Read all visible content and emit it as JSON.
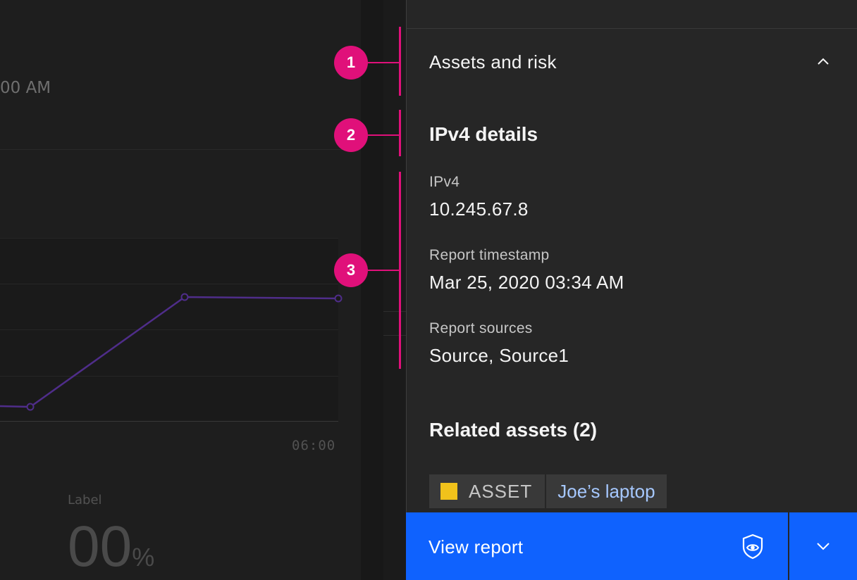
{
  "background": {
    "time_label": "00 AM",
    "tick_label": "06:00",
    "kpi_label": "Label",
    "kpi_value": "00",
    "kpi_unit": "%",
    "line_color": "#4f2d8a"
  },
  "callouts": [
    {
      "number": "1"
    },
    {
      "number": "2"
    },
    {
      "number": "3"
    }
  ],
  "panel": {
    "accordion_title": "Assets and risk",
    "details_title": "IPv4 details",
    "fields": [
      {
        "label": "IPv4",
        "value": "10.245.67.8"
      },
      {
        "label": "Report timestamp",
        "value": "Mar 25, 2020 03:34 AM"
      },
      {
        "label": "Report sources",
        "value": "Source, Source1"
      }
    ],
    "related_title": "Related assets (2)",
    "tag": {
      "type": "ASSET",
      "name": "Joe’s laptop",
      "type_color": "#f1c21b"
    }
  },
  "actions": {
    "primary_label": "View report",
    "primary_icon": "view-report-icon",
    "menu_icon": "chevron-down-icon",
    "accent": "#0f62fe"
  },
  "accent_magenta": "#e0107a"
}
